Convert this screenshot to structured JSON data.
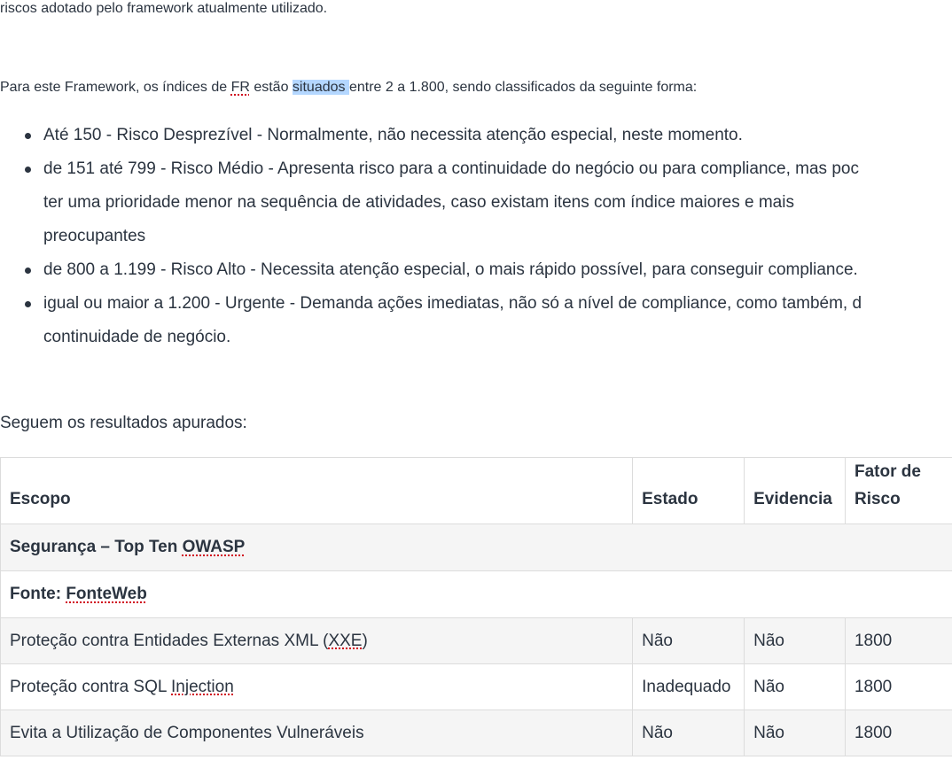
{
  "intro": {
    "top_line": "riscos adotado pelo framework atualmente utilizado.",
    "before_fr": "Para este Framework, os índices de ",
    "fr": "FR",
    "before_highlight": " estão ",
    "highlight": " situados ",
    "after_highlight": "entre 2 a 1.800, sendo classificados da seguinte forma:"
  },
  "risk_levels": [
    {
      "text": "Até 150 - Risco Desprezível - Normalmente, não necessita atenção especial, neste momento."
    },
    {
      "line1": "de 151 até 799 - Risco Médio - Apresenta risco para a continuidade do negócio ou para compliance, mas poc",
      "line2": "ter uma prioridade menor na sequência de atividades, caso existam itens com índice maiores e mais",
      "line3": "preocupantes"
    },
    {
      "text": "de 800 a 1.199 - Risco Alto - Necessita atenção especial, o mais rápido possível, para conseguir compliance."
    },
    {
      "line1": "igual ou maior a 1.200 - Urgente - Demanda ações imediatas, não só a nível de compliance, como também, d",
      "line2": "continuidade de negócio."
    }
  ],
  "results_intro": "Seguem os resultados apurados:",
  "table": {
    "headers": {
      "scope": "Escopo",
      "state": "Estado",
      "evidence": "Evidencia",
      "risk_line1": "Fator de",
      "risk_line2": "Risco"
    },
    "group_title_prefix": "Segurança – Top Ten ",
    "group_title_link": "OWASP",
    "source_prefix": "Fonte: ",
    "source_link": "FonteWeb",
    "rows": [
      {
        "scope_before": "Proteção contra Entidades Externas XML (",
        "scope_spell": "XXE",
        "scope_after": ")",
        "state": "Não",
        "evidence": "Não",
        "risk": "1800"
      },
      {
        "scope_before": "Proteção contra SQL ",
        "scope_spell": "Injection",
        "scope_after": "",
        "state": "Inadequado",
        "evidence": "Não",
        "risk": "1800"
      },
      {
        "scope_before": "Evita a Utilização de Componentes Vulneráveis",
        "scope_spell": "",
        "scope_after": "",
        "state": "Não",
        "evidence": "Não",
        "risk": "1800"
      }
    ]
  }
}
